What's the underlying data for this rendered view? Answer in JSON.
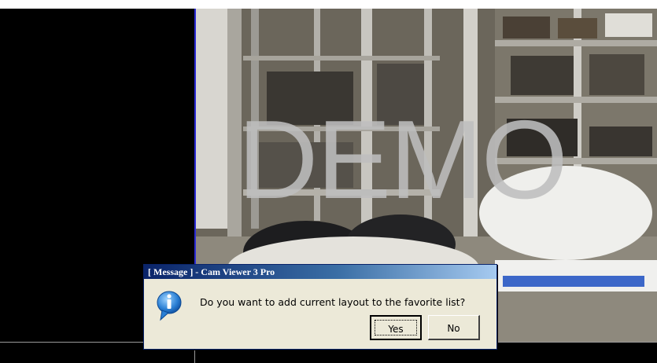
{
  "watermark": {
    "text": "DEMO"
  },
  "dialog": {
    "title": "[ Message ] - Cam Viewer 3 Pro",
    "icon": "info-icon",
    "message": "Do you want to add current layout to the favorite list?",
    "yes_label": "Yes",
    "no_label": "No"
  },
  "colors": {
    "title_bar": "#0a246a",
    "dialog_bg": "#ece9d8",
    "pane_divider": "#2b2bd6",
    "watermark": "#bebebe"
  }
}
